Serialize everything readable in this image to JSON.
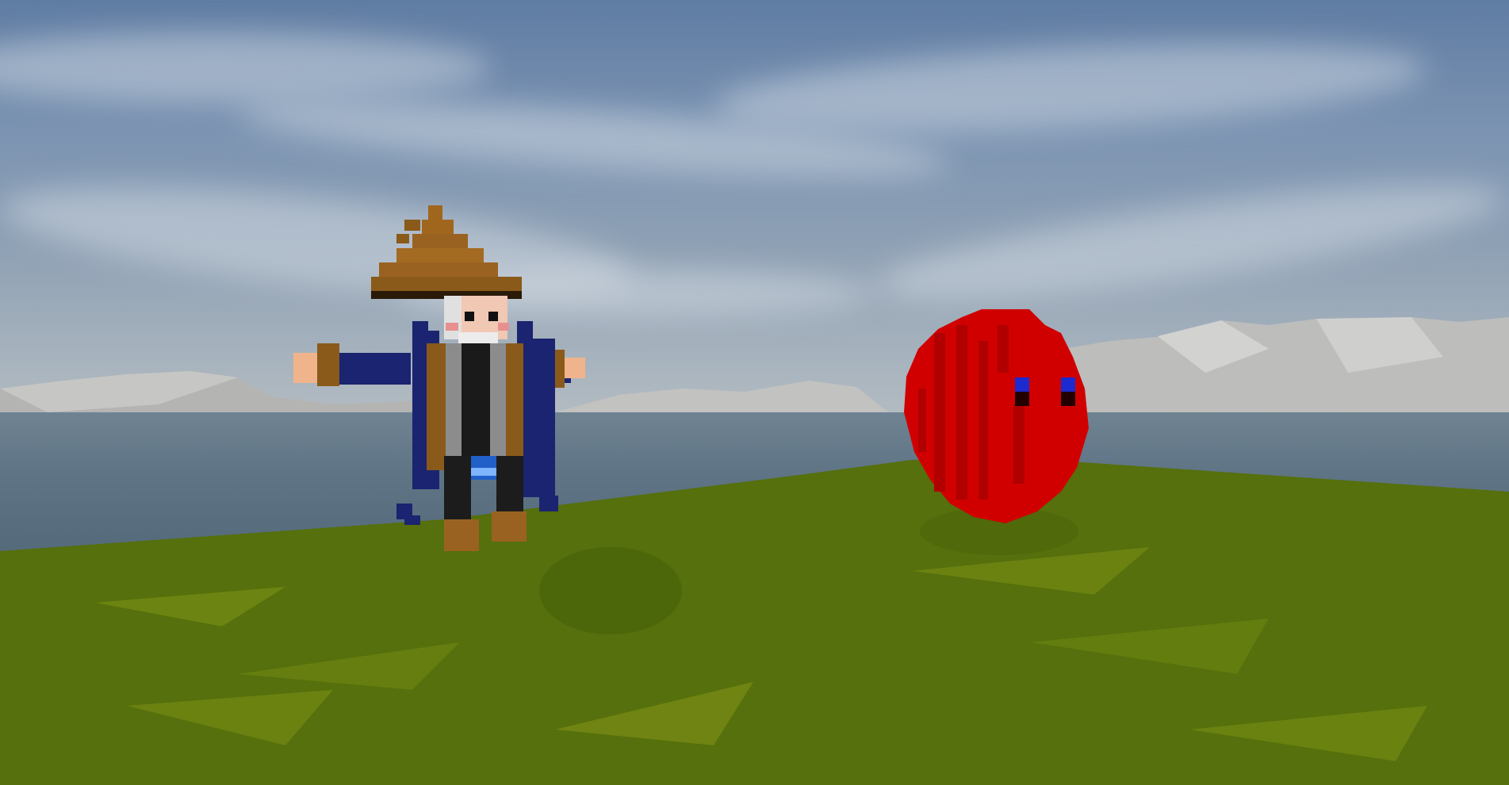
{
  "scene": {
    "type": "3d-voxel-game-view",
    "ui_text": []
  },
  "colors": {
    "sky_top": "#5f7ca3",
    "sky_horizon": "#b9c0c4",
    "mountain": "#b8b8b6",
    "water": "#5f7484",
    "grass": "#55700c",
    "grass_highlight": "#7a8d16",
    "wizard_robe": "#1b2470",
    "wizard_hat": "#8a5a1a",
    "slime": "#d10000",
    "slime_eye": "#1c2ad0"
  },
  "entities": [
    {
      "id": "wizard",
      "icon": "voxel-wizard-character"
    },
    {
      "id": "red-slime",
      "icon": "voxel-red-slime-enemy"
    }
  ]
}
